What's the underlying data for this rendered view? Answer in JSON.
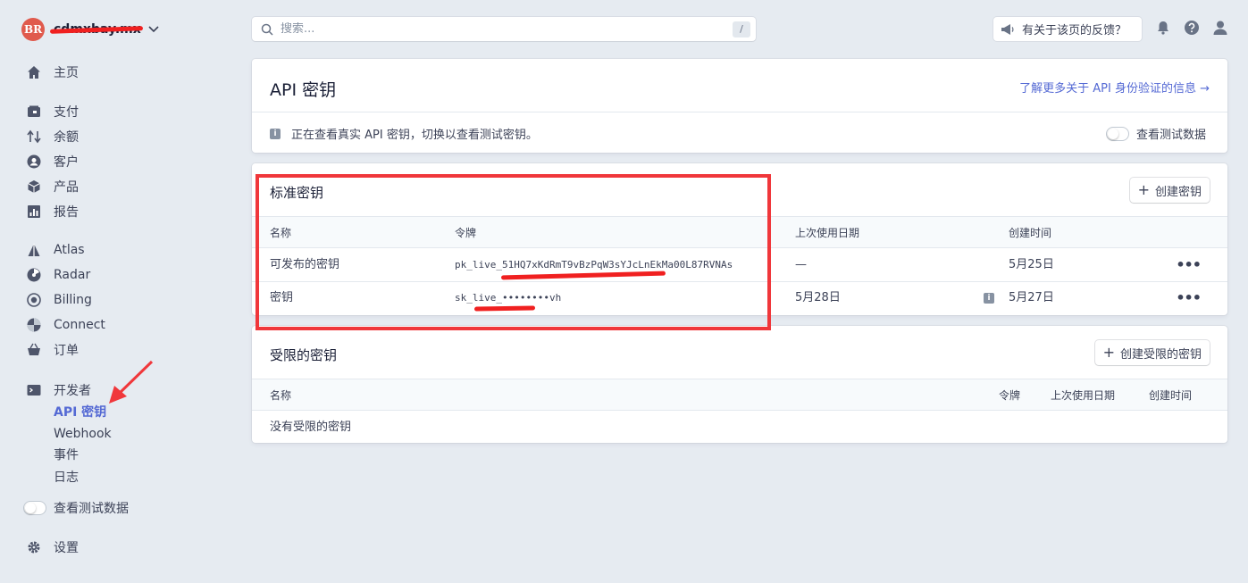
{
  "account": {
    "logo_text": "BR",
    "name": "cdmxbay.mx"
  },
  "sidebar": {
    "home": "主页",
    "payments": "支付",
    "balance": "余额",
    "customers": "客户",
    "products": "产品",
    "reports": "报告",
    "atlas": "Atlas",
    "radar": "Radar",
    "billing": "Billing",
    "connect": "Connect",
    "orders": "订单",
    "developers": "开发者",
    "dev_items": [
      "API 密钥",
      "Webhook",
      "事件",
      "日志"
    ],
    "test_data": "查看测试数据",
    "settings": "设置"
  },
  "search": {
    "placeholder": "搜索...",
    "shortcut": "/"
  },
  "feedback": "有关于该页的反馈？",
  "header_card": {
    "title": "API 密钥",
    "learn_more": "了解更多关于 API 身份验证的信息 →",
    "notice": "正在查看真实 API 密钥，切换以查看测试密钥。",
    "test_toggle": "查看测试数据"
  },
  "standard_keys": {
    "title": "标准密钥",
    "create_button": "创建密钥",
    "columns": [
      "名称",
      "令牌",
      "上次使用日期",
      "创建时间"
    ],
    "rows": [
      {
        "name": "可发布的密钥",
        "token": "pk_live_51HQ7xKdRmT9vBzPqW3sYJcLnEkMa00L87RVNAs",
        "last_used": "—",
        "created": "5月25日"
      },
      {
        "name": "密钥",
        "token": "sk_live_••••••••vh",
        "last_used": "5月28日",
        "created": "5月27日"
      }
    ]
  },
  "restricted_keys": {
    "title": "受限的密钥",
    "create_button": "创建受限的密钥",
    "columns": [
      "名称",
      "令牌",
      "上次使用日期",
      "创建时间"
    ],
    "empty": "没有受限的密钥"
  },
  "colors": {
    "accent": "#5469d4",
    "highlight": "#f0373b",
    "background": "#e6ebf1"
  }
}
